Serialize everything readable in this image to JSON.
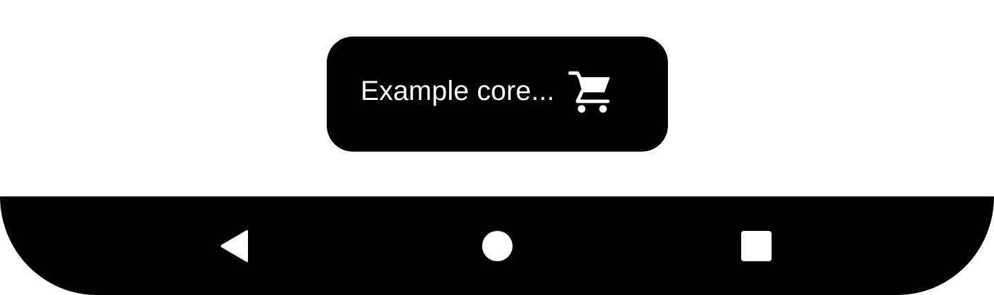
{
  "chip": {
    "label": "Example core...",
    "icon": "shopping-cart-icon"
  },
  "navigation_bar": {
    "back_icon": "back-triangle-icon",
    "home_icon": "home-circle-icon",
    "recents_icon": "recents-square-icon"
  },
  "colors": {
    "background": "#ffffff",
    "bar": "#000000",
    "foreground": "#ffffff"
  }
}
